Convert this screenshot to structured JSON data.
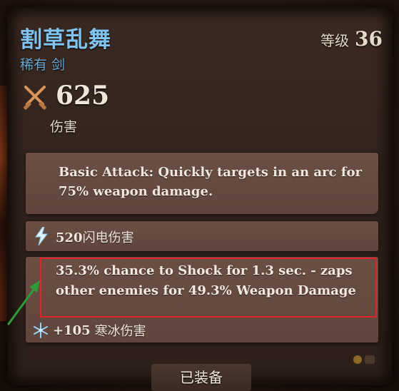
{
  "item": {
    "name": "割草乱舞",
    "rarity_type": "稀有 剑",
    "level_label": "等级",
    "level_value": "36",
    "damage_value": "625",
    "damage_label": "伤害"
  },
  "description": "Basic Attack: Quickly targets in an arc for 75% weapon damage.",
  "stats": {
    "lightning_value": "520",
    "lightning_label": "闪电伤害",
    "effect_text": "35.3% chance to Shock for 1.3 sec. - zaps other enemies for 49.3% Weapon Damage",
    "frost_value": "+105",
    "frost_label": "寒冰伤害"
  },
  "footer": {
    "equipped_label": "已装备"
  },
  "icons": {
    "damage": "crossed-swords-icon",
    "lightning": "lightning-bolt-icon",
    "frost": "snowflake-icon"
  },
  "colors": {
    "title": "#7fc3ee",
    "highlight_box": "#e0262a",
    "arrow": "#2f9a3a",
    "panel": "#33241e",
    "stat_box": "#5f453b"
  }
}
